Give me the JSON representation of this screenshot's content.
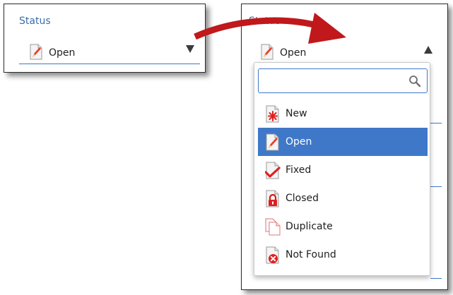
{
  "colors": {
    "accent": "#3f78c9",
    "label": "#3a6ea8",
    "selected_bg": "#3f78c9",
    "arrow": "#c0181b"
  },
  "collapsed": {
    "label": "Status",
    "value": "Open",
    "value_icon": "pencil-document-icon",
    "toggle_icon": "caret-down-icon"
  },
  "expanded": {
    "label": "Status",
    "value": "Open",
    "value_icon": "pencil-document-icon",
    "toggle_icon": "caret-up-icon",
    "search": {
      "value": "",
      "placeholder": "",
      "icon": "search-icon"
    },
    "options": [
      {
        "label": "New",
        "icon": "asterisk-document-icon",
        "selected": false
      },
      {
        "label": "Open",
        "icon": "pencil-document-icon",
        "selected": true
      },
      {
        "label": "Fixed",
        "icon": "checkmark-document-icon",
        "selected": false
      },
      {
        "label": "Closed",
        "icon": "lock-document-icon",
        "selected": false
      },
      {
        "label": "Duplicate",
        "icon": "duplicate-document-icon",
        "selected": false
      },
      {
        "label": "Not Found",
        "icon": "x-circle-document-icon",
        "selected": false
      }
    ]
  },
  "transition_arrow_icon": "curved-arrow-icon"
}
